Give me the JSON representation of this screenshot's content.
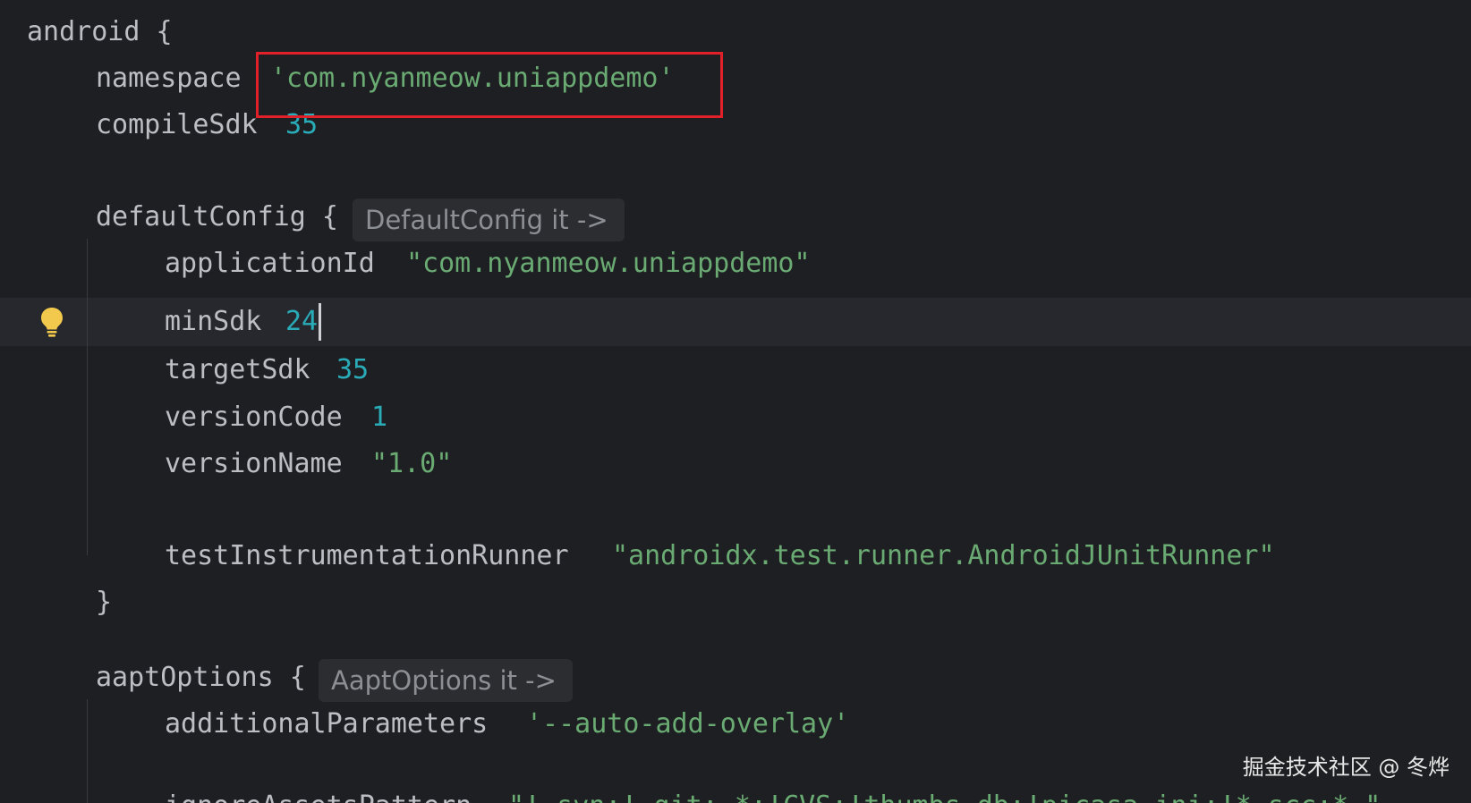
{
  "editor": {
    "lines": {
      "l1": {
        "kw": "android",
        "punct": " {"
      },
      "l2": {
        "kw": "namespace",
        "str": "'com.nyanmeow.uniappdemo'"
      },
      "l3": {
        "kw": "compileSdk",
        "num": "35"
      },
      "l5": {
        "kw": "defaultConfig",
        "punct": " {",
        "hint": "DefaultConfig it ->"
      },
      "l6": {
        "kw": "applicationId",
        "str": "\"com.nyanmeow.uniappdemo\""
      },
      "l7": {
        "kw": "minSdk",
        "num": "24"
      },
      "l8": {
        "kw": "targetSdk",
        "num": "35"
      },
      "l9": {
        "kw": "versionCode",
        "num": "1"
      },
      "l10": {
        "kw": "versionName",
        "str": "\"1.0\""
      },
      "l12": {
        "kw": "testInstrumentationRunner",
        "str": "\"androidx.test.runner.AndroidJUnitRunner\""
      },
      "l13": {
        "punct": "}"
      },
      "l15": {
        "kw": "aaptOptions",
        "punct": " {",
        "hint": "AaptOptions it ->"
      },
      "l16": {
        "kw": "additionalParameters",
        "str": "'--auto-add-overlay'"
      },
      "l17": {
        "kw": "ignoreAssetsPattern",
        "str": "\"!.svn:!.git:.*:!CVS:!thumbs.db:!picasa.ini:!*.scc:*~\""
      }
    }
  },
  "watermark": "掘金技术社区 @ 冬烨",
  "colors": {
    "background": "#1e1f22",
    "identifier": "#bcbec4",
    "string": "#6aab73",
    "number": "#2aacb8",
    "annotation_box": "#e2202a",
    "bulb": "#f2c94c"
  },
  "icons": {
    "intention": "lightbulb-icon"
  }
}
